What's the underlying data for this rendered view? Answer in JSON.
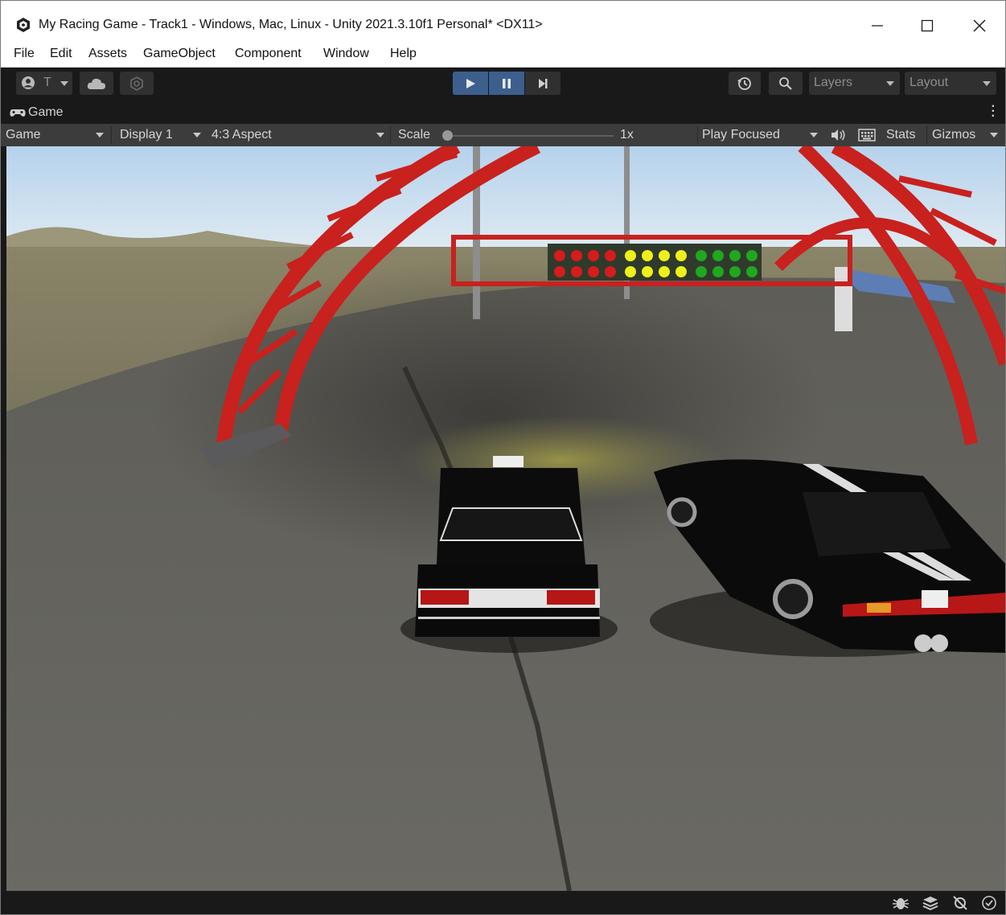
{
  "window": {
    "title": "My Racing Game - Track1 - Windows, Mac, Linux - Unity 2021.3.10f1 Personal* <DX11>",
    "app_icon": "unity-logo-icon",
    "controls": [
      "minimize-icon",
      "maximize-icon",
      "close-icon"
    ]
  },
  "menu": {
    "file": "File",
    "edit": "Edit",
    "assets": "Assets",
    "gameobject": "GameObject",
    "component": "Component",
    "window": "Window",
    "help": "Help"
  },
  "toolbar": {
    "account_label": "T",
    "icons": [
      "account-icon",
      "cloud-icon",
      "collab-icon",
      "history-icon",
      "search-icon"
    ],
    "playmode": [
      "play-icon",
      "pause-icon",
      "step-icon"
    ],
    "play_active_color": "#3c5f8e",
    "layers_label": "Layers",
    "layout_label": "Layout"
  },
  "game_tab": {
    "label": "Game",
    "icon": "gamepad-icon"
  },
  "game_bar": {
    "view_mode": "Game",
    "display": "Display 1",
    "aspect": "4:3 Aspect",
    "scale_label": "Scale",
    "scale_value": 0,
    "scale_text": "1x",
    "play_mode": "Play Focused",
    "mute_icon": "speaker-icon",
    "stats_icon": "keyboard-icon",
    "stats_label": "Stats",
    "gizmos_label": "Gizmos"
  },
  "scene": {
    "start_lights": [
      "red",
      "red",
      "red",
      "red",
      "yellow",
      "yellow",
      "yellow",
      "yellow",
      "green",
      "green",
      "green",
      "green"
    ],
    "arch_color": "#c8211e"
  },
  "status_bar": {
    "icons": [
      "bug-icon",
      "stack-icon",
      "auto-generate-lighting-icon",
      "check-circle-icon"
    ]
  }
}
